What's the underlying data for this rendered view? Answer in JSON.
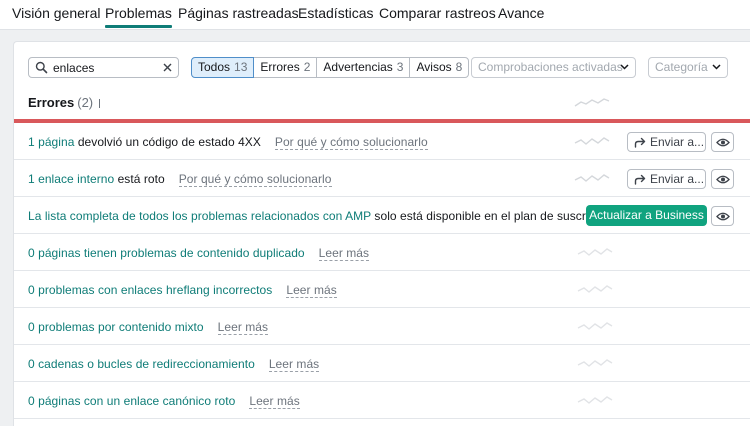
{
  "nav": {
    "tabs": [
      "Visión general",
      "Problemas",
      "Páginas rastreadas",
      "Estadísticas",
      "Comparar rastreos",
      "Avance"
    ],
    "active": "Problemas"
  },
  "toolbar": {
    "search_value": "enlaces",
    "filters": [
      {
        "label": "Todos",
        "count": "13"
      },
      {
        "label": "Errores",
        "count": "2"
      },
      {
        "label": "Advertencias",
        "count": "3"
      },
      {
        "label": "Avisos",
        "count": "8"
      }
    ],
    "checks_placeholder": "Comprobaciones activadas",
    "category_placeholder": "Categoría"
  },
  "section": {
    "title": "Errores",
    "count": "(2)"
  },
  "issues": [
    {
      "link": "1 página",
      "text": " devolvió un código de estado 4XX",
      "why": "Por qué y cómo solucionarlo",
      "send": "Enviar a..."
    },
    {
      "link": "1 enlace interno",
      "text": " está roto",
      "why": "Por qué y cómo solucionarlo",
      "send": "Enviar a..."
    },
    {
      "link": "La lista completa de todos los problemas relacionados con AMP",
      "text": " solo está disponible en el plan de suscripci...",
      "upgrade": "Actualizar a Business"
    },
    {
      "link": "0 páginas tienen problemas de contenido duplicado",
      "more": "Leer más"
    },
    {
      "link": "0 problemas con enlaces hreflang incorrectos",
      "more": "Leer más"
    },
    {
      "link": "0 problemas por contenido mixto",
      "more": "Leer más"
    },
    {
      "link": "0 cadenas o bucles de redireccionamiento",
      "more": "Leer más"
    },
    {
      "link": "0 páginas con un enlace canónico roto",
      "more": "Leer más"
    }
  ],
  "icons": {
    "search": "search-icon",
    "clear": "close-icon",
    "dropdown": "chevron-down-icon",
    "send": "share-arrow-icon",
    "eye": "eye-icon"
  },
  "colors": {
    "accent": "#0e7c77",
    "error_line": "#d9585b",
    "upgrade_button": "#10a37f",
    "active_filter": "#dfeefb"
  }
}
